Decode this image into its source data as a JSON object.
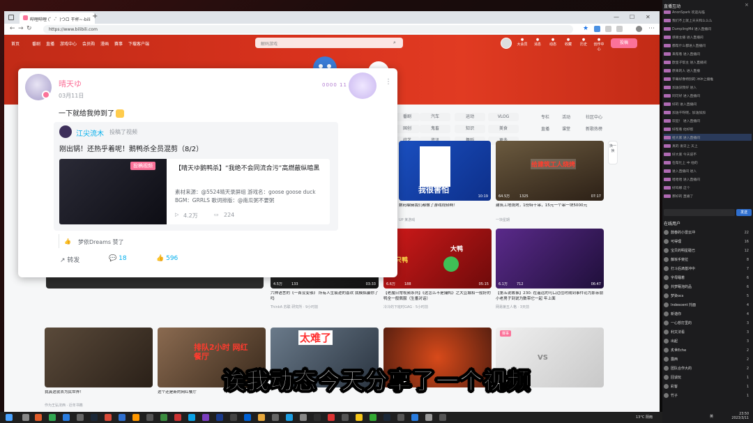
{
  "browser": {
    "tab_title": "哔哩哔哩 (゜-゜)つロ 干杯~-bili",
    "url": "https://www.bilibili.com",
    "new_tab": "+",
    "window_controls": [
      "—",
      "☐",
      "✕"
    ]
  },
  "bilibili": {
    "nav": [
      "首页",
      "番剧",
      "直播",
      "游戏中心",
      "会员购",
      "漫画",
      "赛事",
      "下载客户端"
    ],
    "search_placeholder": "解码游戏",
    "right_icons": [
      "大会员",
      "消息",
      "动态",
      "收藏",
      "历史",
      "创作中心"
    ],
    "upload_label": "投稿",
    "categories": [
      "番剧",
      "国创",
      "综艺",
      "汽车",
      "运动",
      "VLOG",
      "鬼畜",
      "知识",
      "美食",
      "资讯",
      "舞蹈",
      "更多"
    ],
    "right_links": [
      "专栏",
      "活动",
      "社区中心",
      "直播",
      "课堂",
      "新歌热榜"
    ],
    "float_button": "换一换"
  },
  "videos_row1": [
    {
      "title": "数码编辑我们都做了游戏视频啊！",
      "meta": "UP 某游戏",
      "tags": [
        "我很害怕"
      ],
      "duration": "10:19",
      "views": "",
      "danmaku": ""
    },
    {
      "title": "建筑工地烧烤，1份特十串，15元一个串一块5000元",
      "meta": "一块星期",
      "banner": "给建筑工人烧烤",
      "views": "64.5万",
      "danmaku": "1325",
      "duration": "07:17"
    }
  ],
  "videos_row2": [
    {
      "title": "六种语言的《一首没变够》 所有人生痕迹的喜欢 我模拟骗你了吗",
      "meta": "ThinkA 苏联 研究所 · 9小时前",
      "views": "4.5万",
      "danmaku": "133",
      "duration": "03:33"
    },
    {
      "title": "【老魔日常视频系列】《这怎么不是捕鸭》之大豆城和一般好的鸭全一般佩服（生番对话）",
      "meta": "冷冷的下班时GAG · 5小时前",
      "tags": [
        "大鸭",
        "一只鸭"
      ],
      "views": "6.6万",
      "danmaku": "188",
      "duration": "05:15"
    },
    {
      "title": "【第五说故事】230: 在遥远的可口过往时期到事件论为那亲朋 小老男子到说为数带它一起 年上面",
      "meta": "网易第五人格 · 3天前",
      "views": "6.1万",
      "danmaku": "712",
      "duration": "06:47"
    }
  ],
  "videos_row3": [
    {
      "title": "我真这就去为民世界！",
      "meta": "作为王弘法西 · 近年书籍"
    },
    {
      "title": "这个还是新的网红餐厅",
      "meta": "",
      "banner": "排队2小时 网红餐厅"
    },
    {
      "title": "太难了",
      "meta": ""
    },
    {
      "title": "",
      "meta": ""
    },
    {
      "title": "",
      "meta": "",
      "badge": "赛事",
      "vs": "VS"
    }
  ],
  "popup": {
    "username": "晴天ゆ",
    "date": "03月11日",
    "deco_badge": "0000 11",
    "text": "一下就给我帅到了",
    "repost": {
      "user": "江尖流木",
      "action": "投稿了视频",
      "text": "刚出锅！还热乎着呢！鹅鸭杀全员混剪（8/2）",
      "video": {
        "title": "【晴天ゆ鹅鸭杀】“我绝不会同流合污”高燃蔽纵暗黑",
        "desc": "素材来源：@5524晴天录屏组 游戏名：goose goose duck BGM：GRRLS 歌词排版：@南瓜粥不要粥",
        "views": "4.2万",
        "danmaku": "224",
        "thumb_label": "投稿视频"
      }
    },
    "liked_by": "梦依Dreams 赞了",
    "actions": {
      "repost": "转发",
      "comments": "18",
      "likes": "596"
    }
  },
  "subtitle": "诶我动态今天分享了一个视频",
  "taskbar": {
    "time": "23:50",
    "date": "2023/3/11",
    "weather": "13°C 阴雨",
    "lang": "英"
  },
  "stream_panel": {
    "title": "直播互动",
    "chat": [
      "AnonSpark 欢迎光临",
      "我们不上就上天天和么么么",
      "DumplingMd 进入直播间",
      "感谢主播 进入直播间",
      "都帮什么都进入直播间",
      "来帮看 进入直播间",
      "欧皇子帮主 进入直播间",
      "原来的人 进入直播",
      "字幕好像特别的 冲冲上播推",
      "加油没我好 进入",
      "同可好 进入直播间",
      "好的 进入直播间",
      "加油干呀呢，加油加加",
      "欢迎！ 进入直播间",
      "好帮看 他好帮",
      "给大家 进入直播间",
      "真的 发牙上 天上",
      "好大家 今天说不",
      "在帮忙上 中 他的",
      "进入直播间 进入",
      "哈哈哈 进入直播间",
      "好吗哪 这个",
      "那好的 直播了"
    ],
    "chat_input_btn": "发送",
    "users_title": "在线用户",
    "users": [
      {
        "name": "鼓春的小雷云冲",
        "count": "22"
      },
      {
        "name": "可得理",
        "count": "16"
      },
      {
        "name": "宝贝的明星碰已",
        "count": "12"
      },
      {
        "name": "藤坂手斐拉",
        "count": "8"
      },
      {
        "name": "打斗后滴基冲中",
        "count": "7"
      },
      {
        "name": "字母睡着",
        "count": "6"
      },
      {
        "name": "共梦眠泡的品",
        "count": "6"
      },
      {
        "name": "梦染ocs",
        "count": "5"
      },
      {
        "name": "Indescent 托面",
        "count": "4"
      },
      {
        "name": "新谐你",
        "count": "4"
      },
      {
        "name": "一心想打里的",
        "count": "3"
      },
      {
        "name": "利文法看",
        "count": "3"
      },
      {
        "name": "出起",
        "count": "3"
      },
      {
        "name": "炙世Eche",
        "count": "2"
      },
      {
        "name": "露西",
        "count": "2"
      },
      {
        "name": "团队合作大的",
        "count": "2"
      },
      {
        "name": "回谈玩",
        "count": "1"
      },
      {
        "name": "彩客",
        "count": "1"
      },
      {
        "name": "竹子",
        "count": "1"
      }
    ]
  }
}
